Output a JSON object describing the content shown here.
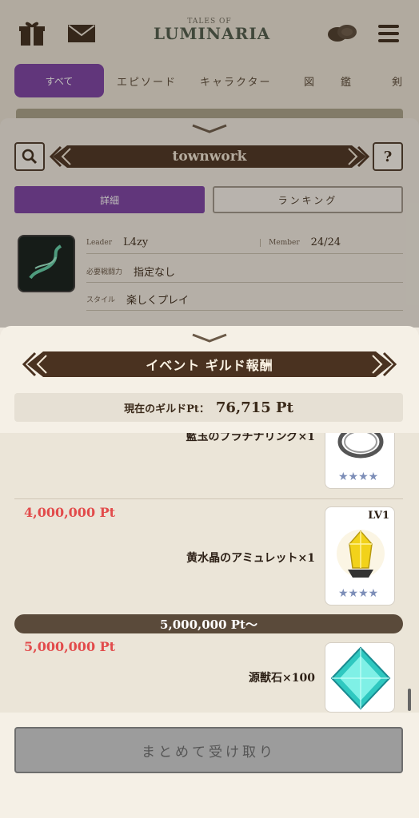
{
  "topbar": {
    "logo_small": "TALES OF",
    "logo_big": "LUMINARIA",
    "gift_icon": "gift-icon",
    "mail_icon": "mail-icon",
    "coins_icon": "coins-icon",
    "menu_icon": "hamburger-menu-icon"
  },
  "nav": {
    "all": "すべて",
    "items": [
      "エピソード",
      "キャラクター",
      "図",
      "鑑",
      "剣"
    ]
  },
  "guild": {
    "name": "townwork",
    "search_icon": "search-icon",
    "help_label": "?",
    "tab_detail": "詳細",
    "tab_ranking": "ランキング",
    "leader_label": "Leader",
    "leader_value": "L4zy",
    "member_label": "Member",
    "member_value": "24/24",
    "power_label": "必要戦闘力",
    "power_value": "指定なし",
    "style_label": "スタイル",
    "style_value": "楽しくプレイ"
  },
  "rewards": {
    "title": "イベント ギルド報酬",
    "current_pt_label": "現在のギルドPt：",
    "current_pt_value": "76,715 Pt",
    "rows": [
      {
        "pt": "",
        "item": "藍玉のプラチナリング×1",
        "level": "",
        "stars": "★★★★"
      },
      {
        "pt": "4,000,000 Pt",
        "item": "黄水晶のアミュレット×1",
        "level": "LV1",
        "stars": "★★★★"
      },
      {
        "pt": "5,000,000 Pt",
        "item": "源獣石×100",
        "level": "",
        "stars": ""
      }
    ],
    "section_label": "5,000,000 Pt～",
    "claim_all": "まとめて受け取り"
  },
  "colors": {
    "accent_purple": "#7a3fa5",
    "banner_brown": "#4a3220",
    "pt_red": "#e24b4b"
  }
}
